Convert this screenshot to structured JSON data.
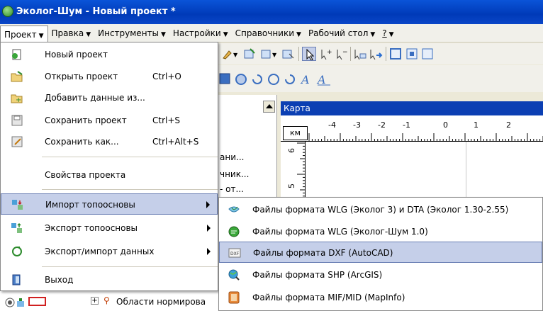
{
  "window": {
    "title": "Эколог-Шум - Новый проект *"
  },
  "menubar": [
    {
      "label": "Проект",
      "open": true
    },
    {
      "label": "Правка"
    },
    {
      "label": "Инструменты"
    },
    {
      "label": "Настройки"
    },
    {
      "label": "Справочники"
    },
    {
      "label": "Рабочий стол"
    },
    {
      "label": "?"
    }
  ],
  "project_menu": {
    "items": [
      {
        "label": "Новый проект",
        "shortcut": "",
        "icon": "new-project-icon"
      },
      {
        "label": "Открыть проект",
        "shortcut": "Ctrl+O",
        "icon": "open-folder-icon"
      },
      {
        "label": "Добавить данные из...",
        "shortcut": "",
        "icon": "add-data-icon"
      },
      {
        "label": "Сохранить проект",
        "shortcut": "Ctrl+S",
        "icon": "save-icon"
      },
      {
        "label": "Сохранить как...",
        "shortcut": "Ctrl+Alt+S",
        "icon": "save-as-icon"
      },
      {
        "label": "Свойства проекта",
        "shortcut": "",
        "icon": ""
      },
      {
        "label": "Импорт топоосновы",
        "shortcut": "",
        "icon": "import-topo-icon",
        "highlighted": true,
        "submenu": true
      },
      {
        "label": "Экспорт топоосновы",
        "shortcut": "",
        "icon": "export-topo-icon",
        "submenu": true
      },
      {
        "label": "Экспорт/импорт данных",
        "shortcut": "",
        "icon": "exchange-data-icon",
        "submenu": true
      },
      {
        "label": "Выход",
        "shortcut": "",
        "icon": "exit-door-icon"
      }
    ]
  },
  "import_submenu": {
    "items": [
      {
        "label": "Файлы формата WLG (Эколог 3) и DTA (Эколог 1.30-2.55)",
        "icon": "wlg-file-icon"
      },
      {
        "label": "Файлы формата WLG (Эколог-Шум 1.0)",
        "icon": "ecolog-noise-icon"
      },
      {
        "label": "Файлы формата DXF (AutoCAD)",
        "icon": "dxf-file-icon",
        "highlighted": true
      },
      {
        "label": "Файлы формата SHP (ArcGIS)",
        "icon": "shp-globe-icon"
      },
      {
        "label": "Файлы формата MIF/MID (MapInfo)",
        "icon": "mapinfo-icon"
      }
    ]
  },
  "left_panel": {
    "partial_texts": [
      "ани...",
      "чник...",
      "- от..."
    ],
    "tree_item": "Области нормирова"
  },
  "map": {
    "title": "Карта",
    "unit": "км",
    "ruler_top": [
      "-4",
      "-3",
      "-2",
      "-1",
      "0",
      "1",
      "2"
    ],
    "ruler_left": [
      "6",
      "5"
    ]
  },
  "colors": {
    "titlebar": "#0a54d8",
    "highlight": "#c5cfe9",
    "map_title": "#0b3fb3"
  }
}
